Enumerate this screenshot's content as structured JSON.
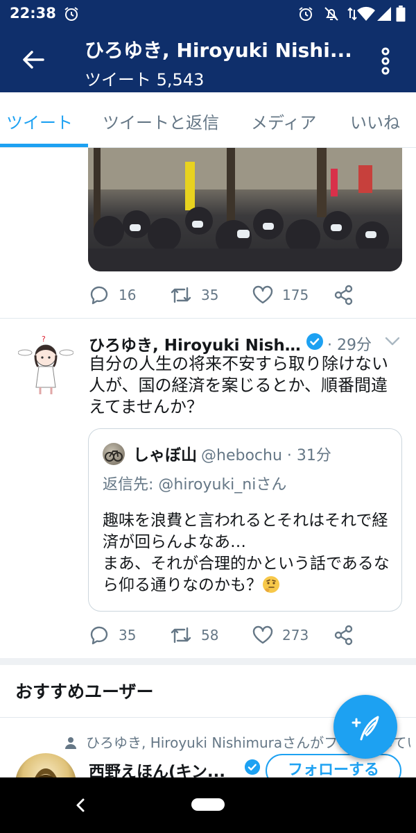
{
  "status_bar": {
    "time": "22:38"
  },
  "header": {
    "title": "ひろゆき, Hiroyuki Nishi...",
    "subtitle": "ツイート 5,543"
  },
  "tabs": [
    {
      "label": "ツイート",
      "active": true
    },
    {
      "label": "ツイートと返信",
      "active": false
    },
    {
      "label": "メディア",
      "active": false
    },
    {
      "label": "いいね",
      "active": false
    }
  ],
  "tweets": [
    {
      "counts": {
        "replies": "16",
        "retweets": "35",
        "likes": "175"
      }
    },
    {
      "name": "ひろゆき, Hiroyuki Nishim...",
      "time": "· 29分",
      "text": "自分の人生の将来不安すら取り除けない人が、国の経済を案じるとか、順番間違えてませんか？",
      "quote": {
        "name": "しゃぼ山",
        "handle": "@hebochu · 31分",
        "reply_to": "返信先: @hiroyuki_niさん",
        "text_line1": "趣味を浪費と言われるとそれはそれで経済が回らんよなあ…",
        "text_line2": "まあ、それが合理的かという話であるなら仰る通りなのかも？"
      },
      "counts": {
        "replies": "35",
        "retweets": "58",
        "likes": "273"
      }
    }
  ],
  "recommendations": {
    "title": "おすすめユーザー",
    "context": "ひろゆき, Hiroyuki Nishimuraさんがフォローしています",
    "user": {
      "name": "西野えほん(キン...",
      "follow_label": "フォローする"
    }
  },
  "colors": {
    "header_bg": "#0f2f6b",
    "accent": "#1da1f2",
    "secondary_text": "#657786"
  }
}
